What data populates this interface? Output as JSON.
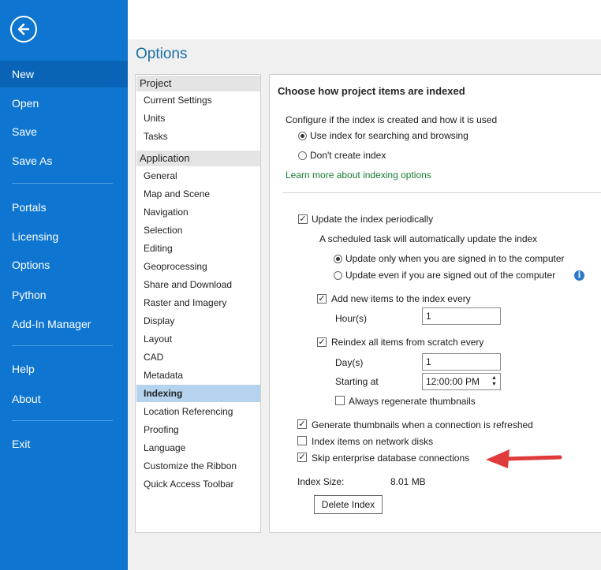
{
  "nav": {
    "items": [
      {
        "label": "New"
      },
      {
        "label": "Open"
      },
      {
        "label": "Save"
      },
      {
        "label": "Save As"
      },
      {
        "label": "Portals"
      },
      {
        "label": "Licensing"
      },
      {
        "label": "Options"
      },
      {
        "label": "Python"
      },
      {
        "label": "Add-In Manager"
      },
      {
        "label": "Help"
      },
      {
        "label": "About"
      },
      {
        "label": "Exit"
      }
    ],
    "active": "New"
  },
  "options_title": "Options",
  "categories": {
    "project_header": "Project",
    "project_items": [
      "Current Settings",
      "Units",
      "Tasks"
    ],
    "application_header": "Application",
    "application_items": [
      "General",
      "Map and Scene",
      "Navigation",
      "Selection",
      "Editing",
      "Geoprocessing",
      "Share and Download",
      "Raster and Imagery",
      "Display",
      "Layout",
      "CAD",
      "Metadata",
      "Indexing",
      "Location Referencing",
      "Proofing",
      "Language",
      "Customize the Ribbon",
      "Quick Access Toolbar"
    ],
    "selected": "Indexing"
  },
  "panel": {
    "section_title": "Choose how project items are indexed",
    "configure_label": "Configure if the index is created and how it is used",
    "radio_use_index": {
      "label": "Use index for searching and browsing",
      "checked": true
    },
    "radio_dont_create": {
      "label": "Don't create index",
      "checked": false
    },
    "learn_more_link": "Learn more about indexing options",
    "update_periodically": {
      "label": "Update the index periodically",
      "checked": true
    },
    "scheduled_task_label": "A scheduled task will automatically update the index",
    "radio_signed_in": {
      "label": "Update only when you are signed in to the computer",
      "checked": true
    },
    "radio_signed_out": {
      "label": "Update even if you are signed out of the computer",
      "checked": false
    },
    "add_new_items": {
      "label": "Add new items to the index every",
      "checked": true
    },
    "hours_label": "Hour(s)",
    "hours_value": "1",
    "reindex_all": {
      "label": "Reindex all items from scratch every",
      "checked": true
    },
    "days_label": "Day(s)",
    "days_value": "1",
    "starting_at_label": "Starting at",
    "starting_at_value": "12:00:00 PM",
    "regen_thumbnails": {
      "label": "Always regenerate thumbnails",
      "checked": false
    },
    "gen_thumbnails": {
      "label": "Generate thumbnails when a connection is refreshed",
      "checked": true
    },
    "network_disks": {
      "label": "Index items on network disks",
      "checked": false
    },
    "skip_enterprise": {
      "label": "Skip enterprise database connections",
      "checked": true
    },
    "index_size_label": "Index Size:",
    "index_size_value": "8.01 MB",
    "delete_button": "Delete Index",
    "check_glyph": "✓"
  },
  "colors": {
    "nav_bg": "#0e76d0",
    "title_blue": "#1a6fa5",
    "link_green": "#167c2e",
    "selected_bg": "#b5d3ee",
    "arrow_red": "#e03a3a"
  }
}
